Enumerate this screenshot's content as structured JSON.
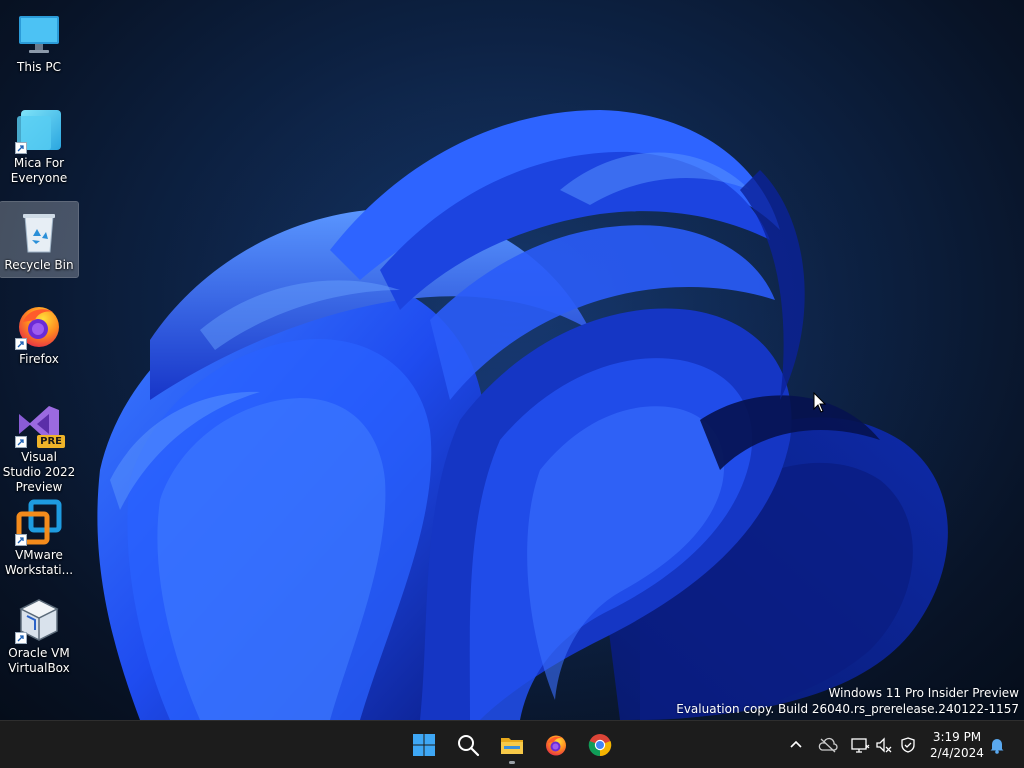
{
  "desktop": {
    "icons": [
      {
        "label": "This PC",
        "icon": "monitor-icon",
        "selected": false
      },
      {
        "label": "Mica For Everyone",
        "icon": "mica-app-icon",
        "selected": false
      },
      {
        "label": "Recycle Bin",
        "icon": "recycle-bin-icon",
        "selected": true
      },
      {
        "label": "Firefox",
        "icon": "firefox-icon",
        "selected": false
      },
      {
        "label": "Visual Studio 2022 Preview",
        "icon": "visual-studio-icon",
        "badge": "PRE",
        "selected": false
      },
      {
        "label": "VMware Workstati...",
        "icon": "vmware-icon",
        "selected": false
      },
      {
        "label": "Oracle VM VirtualBox",
        "icon": "virtualbox-icon",
        "selected": false
      }
    ],
    "watermark": {
      "line1": "Windows 11 Pro Insider Preview",
      "line2": "Evaluation copy. Build 26040.rs_prerelease.240122-1157"
    }
  },
  "taskbar": {
    "pinned": [
      {
        "name": "Start",
        "icon": "windows-start-icon",
        "running": false
      },
      {
        "name": "Search",
        "icon": "search-icon",
        "running": false
      },
      {
        "name": "File Explorer",
        "icon": "folder-icon",
        "running": true
      },
      {
        "name": "Firefox",
        "icon": "firefox-icon",
        "running": false
      },
      {
        "name": "Google Chrome",
        "icon": "chrome-icon",
        "running": false
      }
    ],
    "tray": [
      "chevron-up-icon",
      "onedrive-icon",
      "network-icon",
      "volume-muted-icon",
      "security-icon",
      "notification-bell-icon"
    ],
    "clock": {
      "time": "3:19 PM",
      "date": "2/4/2024"
    }
  },
  "colors": {
    "taskbar_bg": "#1c1c1c",
    "wallpaper_bloom": "#1f4cf0",
    "desktop_bg": "#0a1a33"
  }
}
